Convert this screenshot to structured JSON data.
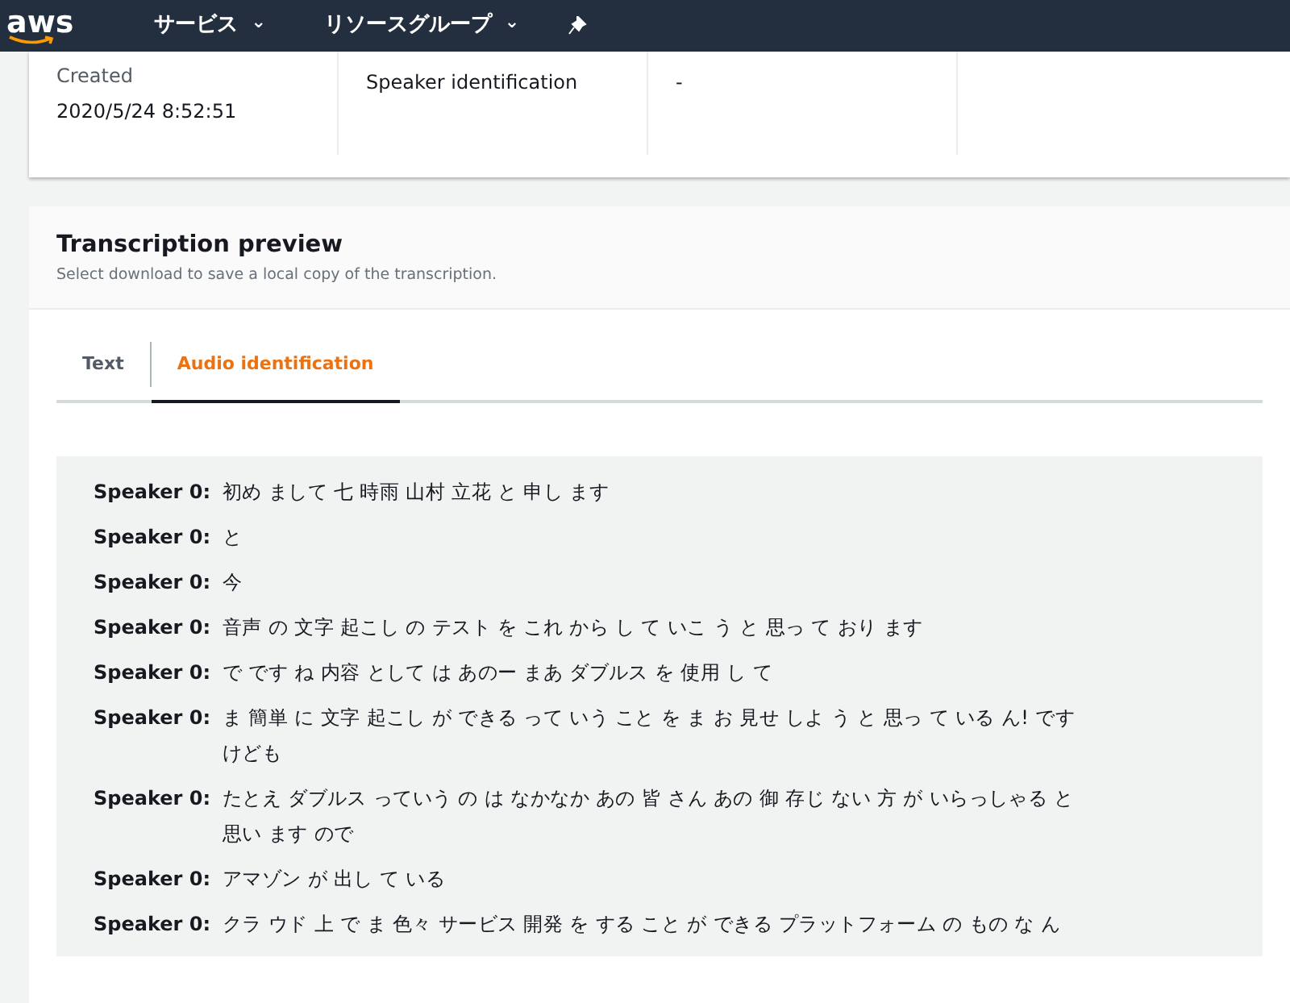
{
  "navbar": {
    "logo": "aws",
    "menus": [
      {
        "label": "サービス",
        "caret": "⌄"
      },
      {
        "label": "リソースグループ",
        "caret": "⌄"
      }
    ]
  },
  "details": [
    {
      "label": "Created",
      "value": "2020/5/24 8:52:51"
    },
    {
      "value": "Speaker identification"
    },
    {
      "value": "-"
    }
  ],
  "preview": {
    "title": "Transcription preview",
    "subtitle": "Select download to save a local copy of the transcription.",
    "tabs": [
      {
        "label": "Text",
        "selected": false
      },
      {
        "label": "Audio identification",
        "selected": true
      }
    ],
    "lines": [
      {
        "speaker": "Speaker 0:",
        "text": "初め まして 七 時雨 山村 立花 と 申し ます"
      },
      {
        "speaker": "Speaker 0:",
        "text": "と"
      },
      {
        "speaker": "Speaker 0:",
        "text": "今"
      },
      {
        "speaker": "Speaker 0:",
        "text": "音声 の 文字 起こし の テスト を これ から し て いこ う と 思っ て おり ます"
      },
      {
        "speaker": "Speaker 0:",
        "text": "で です ね 内容 として は あのー まあ ダブルス を 使用 し て"
      },
      {
        "speaker": "Speaker 0:",
        "text": "ま 簡単 に 文字 起こし が できる って いう こと を ま お 見せ しよ う と 思っ て いる ん! ですけども"
      },
      {
        "speaker": "Speaker 0:",
        "text": "たとえ ダブルス っていう の は なかなか あの 皆 さん あの 御 存じ ない 方 が いらっしゃる と思い ます ので"
      },
      {
        "speaker": "Speaker 0:",
        "text": "アマゾン が 出し て いる"
      },
      {
        "speaker": "Speaker 0:",
        "text": "クラ ウド 上 で ま 色々 サービス 開発 を する こと が できる プラットフォーム の もの な ん"
      }
    ]
  }
}
